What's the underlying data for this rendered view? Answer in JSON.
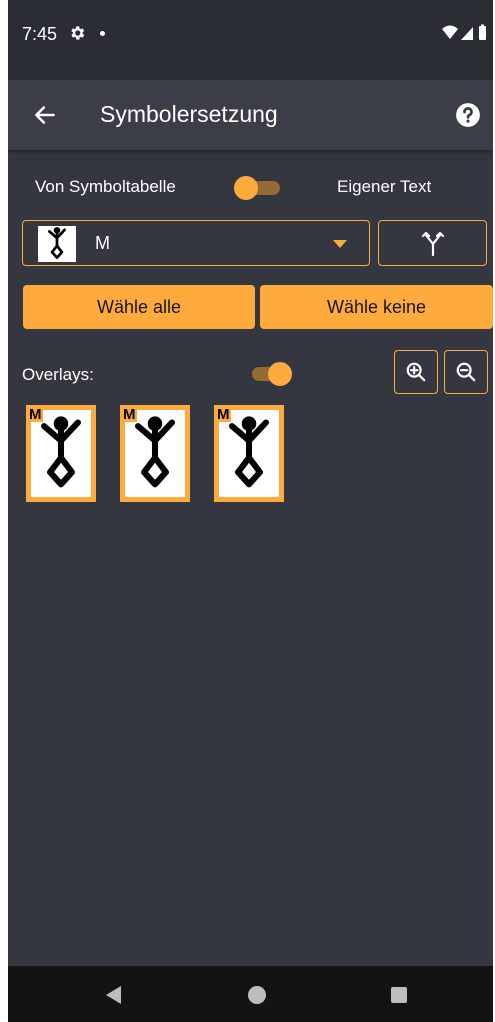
{
  "status_bar": {
    "time": "7:45",
    "icons": [
      "gear-icon",
      "notification-dot",
      "wifi-icon",
      "signal-icon",
      "battery-icon"
    ]
  },
  "app_bar": {
    "back_icon": "arrow-left-icon",
    "title": "Symbolersetzung",
    "help_icon": "help-circle-icon"
  },
  "mode": {
    "left_label": "Von Symboltabelle",
    "right_label": "Eigener Text",
    "toggle_on": false
  },
  "symbol_select": {
    "selected_value": "M",
    "thumbnail_icon": "stick-figure-icon",
    "dropdown_icon": "caret-down-icon"
  },
  "branch_button": {
    "icon": "branch-arrows-icon"
  },
  "buttons": {
    "select_all": "Wähle alle",
    "select_none": "Wähle keine"
  },
  "overlays": {
    "label": "Overlays:",
    "toggle_on": true,
    "zoom_in_icon": "zoom-in-icon",
    "zoom_out_icon": "zoom-out-icon"
  },
  "tiles": [
    {
      "letter": "M",
      "icon": "stick-figure-icon"
    },
    {
      "letter": "M",
      "icon": "stick-figure-icon"
    },
    {
      "letter": "M",
      "icon": "stick-figure-icon"
    }
  ],
  "nav_bar": {
    "icons": [
      "nav-back-icon",
      "nav-home-icon",
      "nav-recents-icon"
    ]
  },
  "colors": {
    "accent": "#ffaa3d",
    "background": "#343640",
    "app_bar": "#3c3e47",
    "status_bar": "#2b2d34",
    "nav_bar": "#131316"
  }
}
